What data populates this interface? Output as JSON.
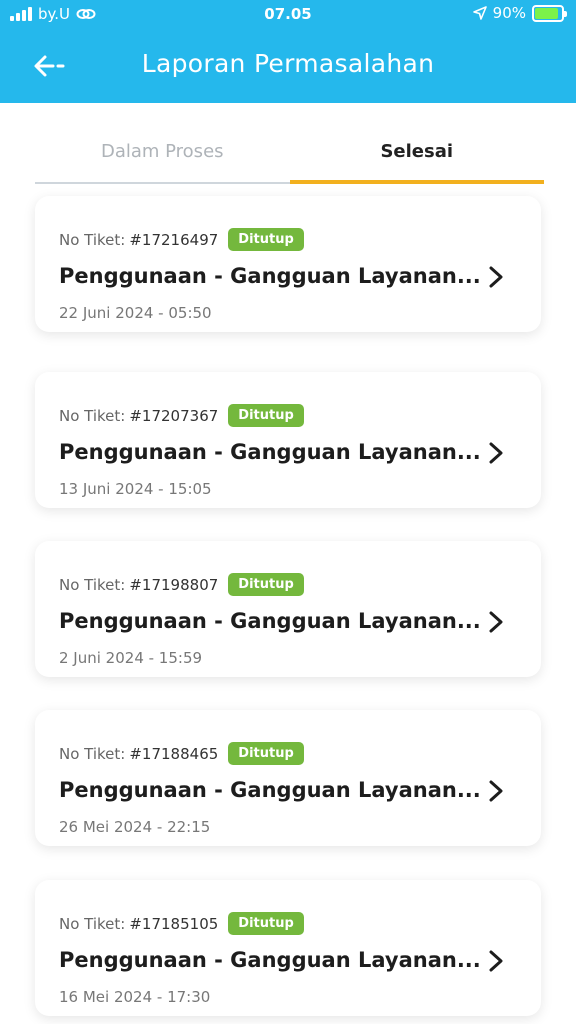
{
  "status_bar": {
    "carrier": "by.U",
    "time": "07.05",
    "battery": "90%",
    "battery_level": 0.9
  },
  "header": {
    "title": "Laporan Permasalahan"
  },
  "tabs": [
    {
      "label": "Dalam Proses",
      "active": false
    },
    {
      "label": "Selesai",
      "active": true
    }
  ],
  "tickets": [
    {
      "prefix": "No Tiket:",
      "number": "#17216497",
      "status": "Ditutup",
      "title": "Penggunaan - Gangguan Layanan...",
      "date": "22 Juni 2024 - 05:50"
    },
    {
      "prefix": "No Tiket:",
      "number": "#17207367",
      "status": "Ditutup",
      "title": "Penggunaan - Gangguan Layanan...",
      "date": "13 Juni 2024 - 15:05"
    },
    {
      "prefix": "No Tiket:",
      "number": "#17198807",
      "status": "Ditutup",
      "title": "Penggunaan - Gangguan Layanan...",
      "date": "2 Juni 2024 - 15:59"
    },
    {
      "prefix": "No Tiket:",
      "number": "#17188465",
      "status": "Ditutup",
      "title": "Penggunaan - Gangguan Layanan...",
      "date": "26 Mei 2024 - 22:15"
    },
    {
      "prefix": "No Tiket:",
      "number": "#17185105",
      "status": "Ditutup",
      "title": "Penggunaan - Gangguan Layanan...",
      "date": "16 Mei 2024 - 17:30"
    }
  ],
  "colors": {
    "header_bg": "#25b8ec",
    "active_tab_underline": "#f2b01e",
    "badge_bg": "#74b83d"
  }
}
